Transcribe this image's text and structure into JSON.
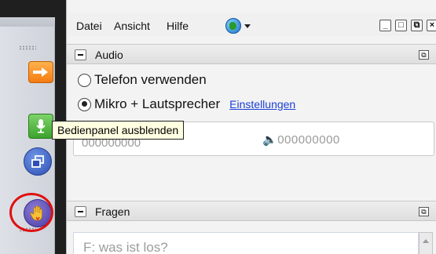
{
  "menu": {
    "items": [
      "Datei",
      "Ansicht",
      "Hilfe"
    ],
    "globe_icon": "globe-icon",
    "window_buttons": [
      "minimize-icon",
      "maximize-icon",
      "restore-icon",
      "close-icon"
    ]
  },
  "audio": {
    "title": "Audio",
    "options": [
      {
        "label": "Telefon verwenden",
        "selected": false
      },
      {
        "label": "Mikro + Lautsprecher",
        "selected": true
      }
    ],
    "settings_link": "Einstellungen",
    "speaker_value": "000000000",
    "hidden_value": "000000000"
  },
  "tooltip": {
    "text": "Bedienpanel ausblenden"
  },
  "fragen": {
    "title": "Fragen",
    "placeholder": "F: was ist los?"
  },
  "sidebar": {
    "buttons": [
      "arrow-icon",
      "microphone-icon",
      "window-switch-icon",
      "raise-hand-icon"
    ],
    "highlight_color": "#e01010"
  }
}
